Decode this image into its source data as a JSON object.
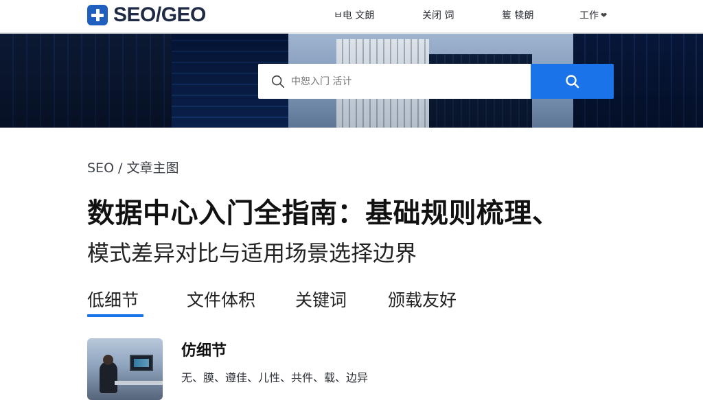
{
  "header": {
    "logo_text": "SEO/GEO",
    "nav": [
      "ㅂ电 文朗",
      "关闭 饲",
      "篗 犊朗",
      "工作"
    ]
  },
  "search": {
    "placeholder": "中恕入门 活计"
  },
  "breadcrumb": "SEO / 文章主图",
  "title": {
    "line1": "数据中心入门全指南：基础规则梳理、",
    "line2": "模式差异对比与适用场景选择边界"
  },
  "tabs": [
    "低细节",
    "文件体积",
    "关键词",
    "颁载友好"
  ],
  "active_tab_index": 0,
  "card": {
    "title": "仿细节",
    "tags": "无、膜、遵佳、儿性、共件、载、边异"
  },
  "colors": {
    "accent": "#1a73e8",
    "logo": "#1f5fbf"
  }
}
